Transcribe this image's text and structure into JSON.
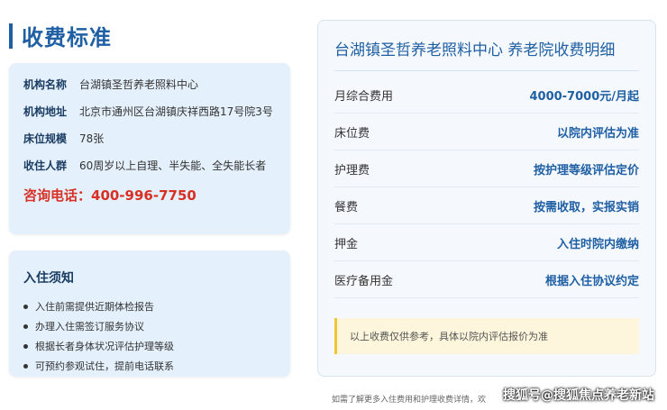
{
  "page_title": "收费标准",
  "info": {
    "rows": [
      {
        "label": "机构名称",
        "value": "台湖镇圣哲养老照料中心"
      },
      {
        "label": "机构地址",
        "value": "北京市通州区台湖镇庆祥西路17号院3号"
      },
      {
        "label": "床位规模",
        "value": "78张"
      },
      {
        "label": "收住人群",
        "value": "60周岁以上自理、半失能、全失能长者"
      }
    ],
    "phone": "咨询电话：400-996-7750"
  },
  "notice": {
    "title": "入住须知",
    "items": [
      "入住前需提供近期体检报告",
      "办理入住需签订服务协议",
      "根据长者身体状况评估护理等级",
      "可预约参观试住，提前电话联系"
    ]
  },
  "fees": {
    "title": "台湖镇圣哲养老照料中心 养老院收费明细",
    "rows": [
      {
        "label": "月综合费用",
        "value": "4000-7000元/月起"
      },
      {
        "label": "床位费",
        "value": "以院内评估为准"
      },
      {
        "label": "护理费",
        "value": "按护理等级评估定价"
      },
      {
        "label": "餐费",
        "value": "按需收取，实报实销"
      },
      {
        "label": "押金",
        "value": "入住时院内缴纳"
      },
      {
        "label": "医疗备用金",
        "value": "根据入住协议约定"
      }
    ],
    "tip": "以上收费仅供参考，具体以院内评估报价为准"
  },
  "footer_text": "如需了解更多入住费用和护理收费详情，欢",
  "watermark": "搜狐号@搜狐焦点养老新站",
  "colors": {
    "accent": "#1f5fa3",
    "phone": "#d93025",
    "card_bg": "#e4f0fb",
    "tip_border": "#f0c53a"
  }
}
